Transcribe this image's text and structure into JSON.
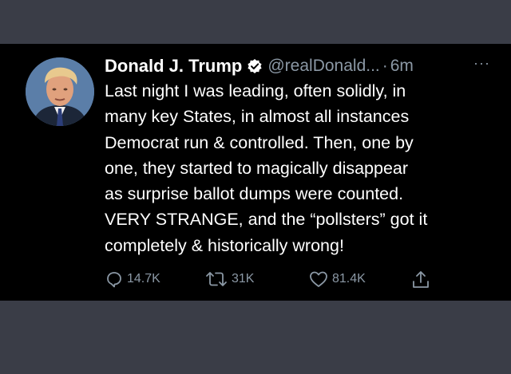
{
  "tweet": {
    "name": "Donald J. Trump",
    "handle": "@realDonald...",
    "separator": "·",
    "time": "6m",
    "more": "···",
    "text_lines": [
      "Last night I was leading, often solidly, in",
      "many key States, in almost all instances",
      "Democrat run & controlled. Then, one by",
      "one, they started to magically disappear",
      "as surprise ballot dumps were counted.",
      "VERY STRANGE, and the “pollsters” got it",
      "completely & historically wrong!"
    ],
    "replies": "14.7K",
    "retweets": "31K",
    "likes": "81.4K"
  },
  "icons": {
    "verified": "verified-badge-icon",
    "reply": "reply-icon",
    "retweet": "retweet-icon",
    "like": "heart-icon",
    "share": "share-icon"
  },
  "colors": {
    "background": "#3a3d47",
    "tweet_background": "#000000",
    "text": "#ffffff",
    "muted": "#8b98a5",
    "verified": "#ffffff"
  }
}
